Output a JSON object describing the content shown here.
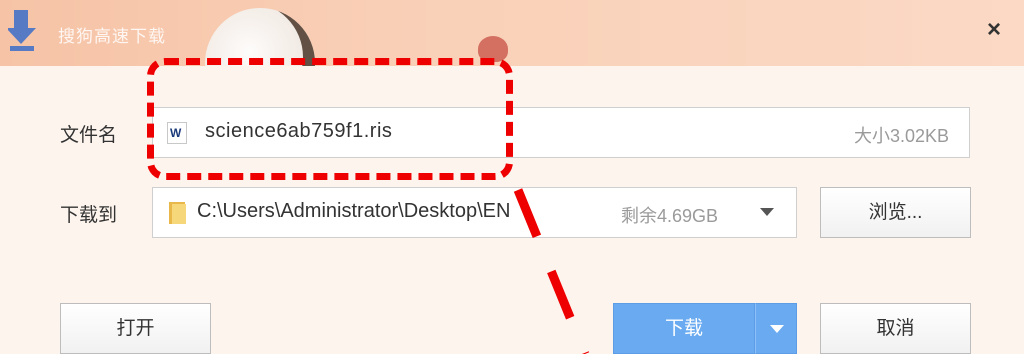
{
  "window": {
    "title": "搜狗高速下载",
    "close_label": "×"
  },
  "file": {
    "label": "文件名",
    "name": "science6ab759f1.ris",
    "size": "大小3.02KB",
    "icon_glyph": "W"
  },
  "destination": {
    "label": "下载到",
    "path": "C:\\Users\\Administrator\\Desktop\\EN",
    "free_space": "剩余4.69GB",
    "browse_label": "浏览..."
  },
  "actions": {
    "open_label": "打开",
    "download_label": "下载",
    "cancel_label": "取消"
  },
  "colors": {
    "accent": "#6aaaf0",
    "annotation": "#ee0000",
    "title_bar": "#f9d0b7"
  }
}
